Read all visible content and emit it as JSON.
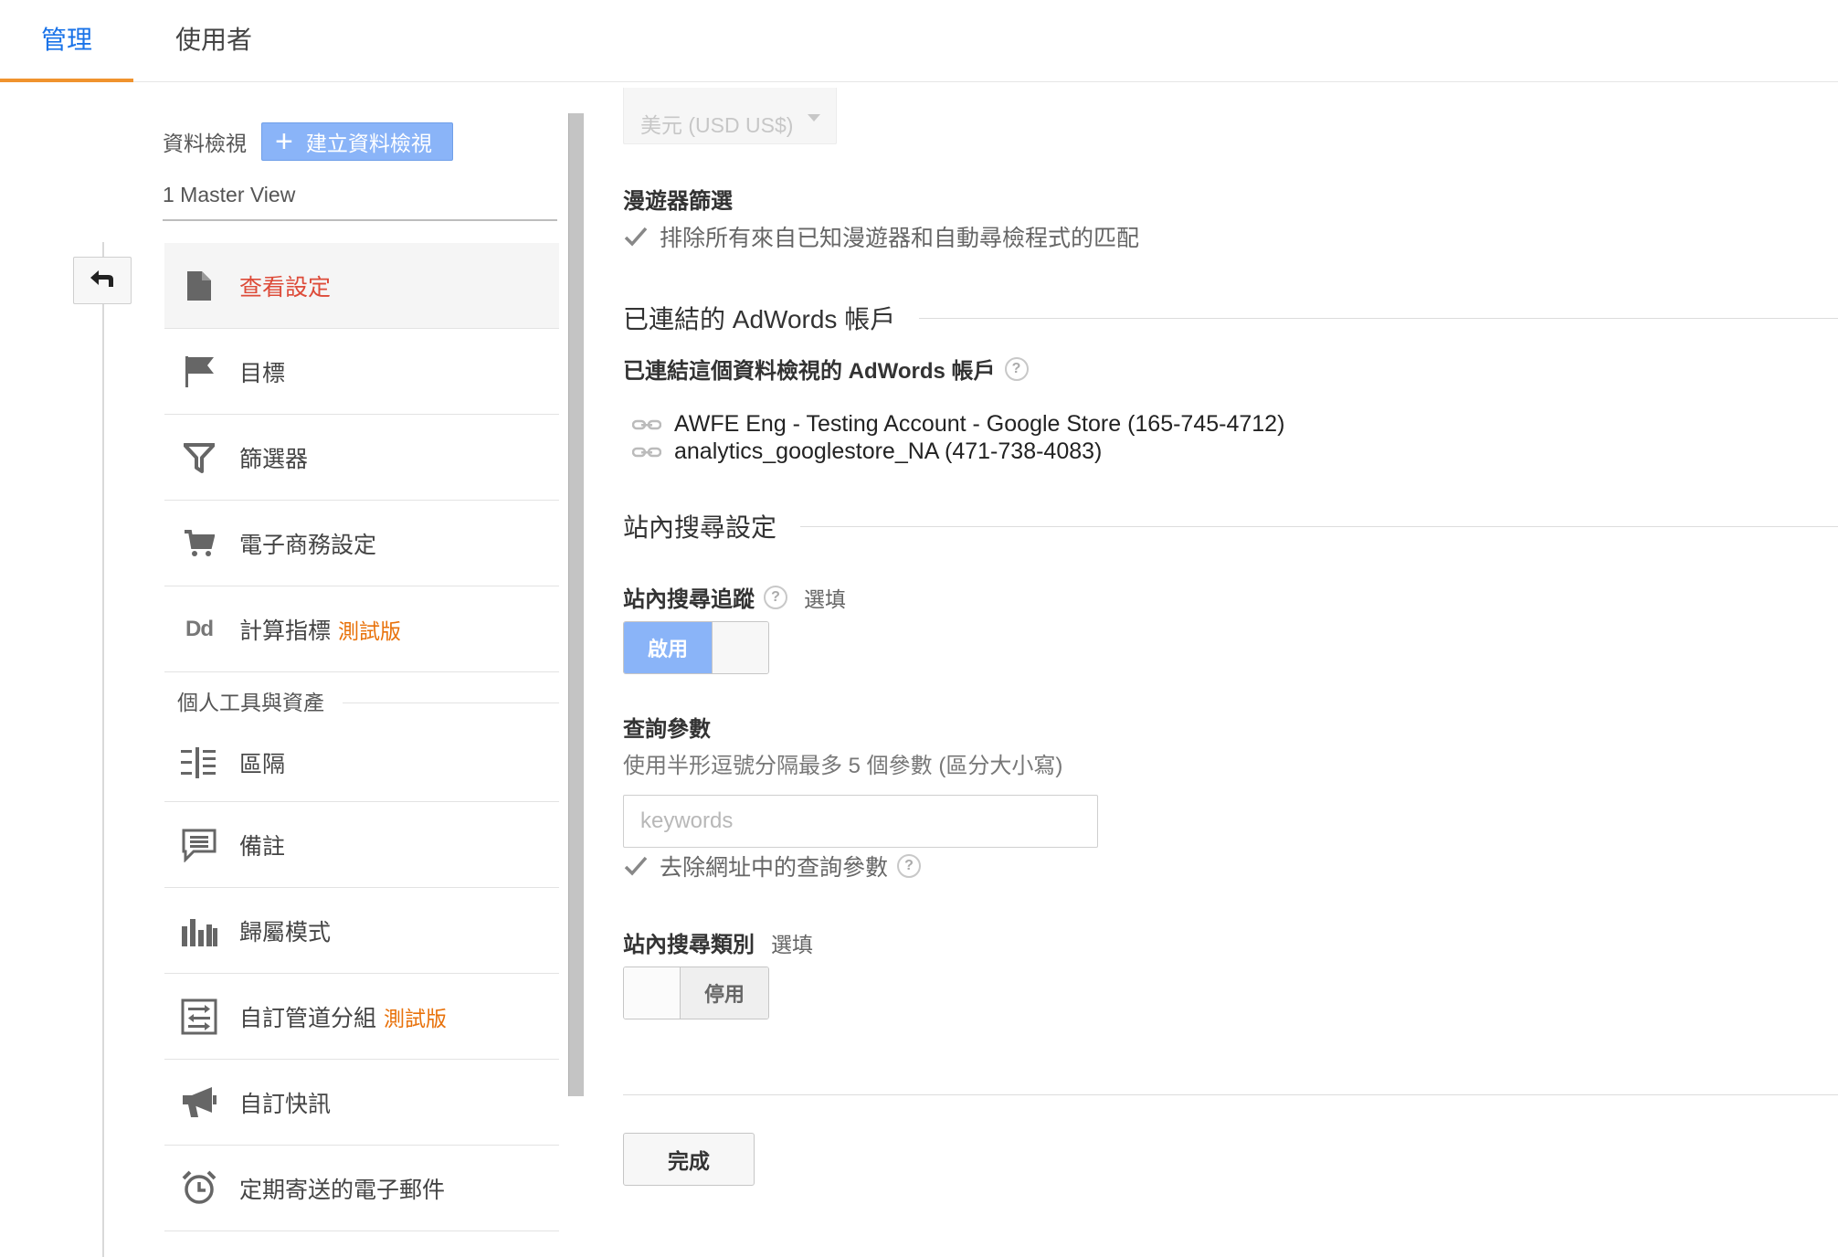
{
  "tabs": [
    {
      "label": "管理",
      "active": true
    },
    {
      "label": "使用者",
      "active": false
    }
  ],
  "accent_color": "#1a73e8",
  "tab_underline_color": "#f0932e",
  "view": {
    "label": "資料檢視",
    "create_button": "建立資料檢視",
    "selected": "1 Master View"
  },
  "nav": {
    "items": [
      {
        "label": "查看設定",
        "icon": "document-icon",
        "active": true
      },
      {
        "label": "目標",
        "icon": "flag-icon"
      },
      {
        "label": "篩選器",
        "icon": "filter-icon"
      },
      {
        "label": "電子商務設定",
        "icon": "cart-icon"
      },
      {
        "label": "計算指標",
        "icon": "dd-icon",
        "icon_text": "Dd",
        "badge": "測試版"
      }
    ],
    "section_title": "個人工具與資產",
    "section_items": [
      {
        "label": "區隔",
        "icon": "segments-icon"
      },
      {
        "label": "備註",
        "icon": "annotation-icon"
      },
      {
        "label": "歸屬模式",
        "icon": "attribution-icon"
      },
      {
        "label": "自訂管道分組",
        "icon": "channel-grouping-icon",
        "badge": "測試版"
      },
      {
        "label": "自訂快訊",
        "icon": "megaphone-icon"
      },
      {
        "label": "定期寄送的電子郵件",
        "icon": "alarm-clock-icon"
      }
    ]
  },
  "settings": {
    "currency": "美元 (USD US$)",
    "bot_filter": {
      "title": "漫遊器篩選",
      "checkbox_label": "排除所有來自已知漫遊器和自動尋檢程式的匹配",
      "checked": true
    },
    "adwords": {
      "section_title": "已連結的 AdWords 帳戶",
      "field_title": "已連結這個資料檢視的 AdWords 帳戶",
      "help": "?",
      "accounts": [
        "AWFE Eng - Testing Account - Google Store (165-745-4712)",
        "analytics_googlestore_NA (471-738-4083)"
      ]
    },
    "site_search": {
      "section_title": "站內搜尋設定",
      "tracking_title": "站內搜尋追蹤",
      "help": "?",
      "optional": "選填",
      "tracking_toggle": {
        "state": "on",
        "label": "啟用"
      },
      "query_param_title": "查詢參數",
      "query_param_hint": "使用半形逗號分隔最多 5 個參數 (區分大小寫)",
      "query_param_placeholder": "keywords",
      "strip_label": "去除網址中的查詢參數",
      "strip_checked": true,
      "categories_title": "站內搜尋類別",
      "categories_optional": "選填",
      "categories_toggle": {
        "state": "off",
        "label": "停用"
      }
    },
    "done_button": "完成"
  }
}
